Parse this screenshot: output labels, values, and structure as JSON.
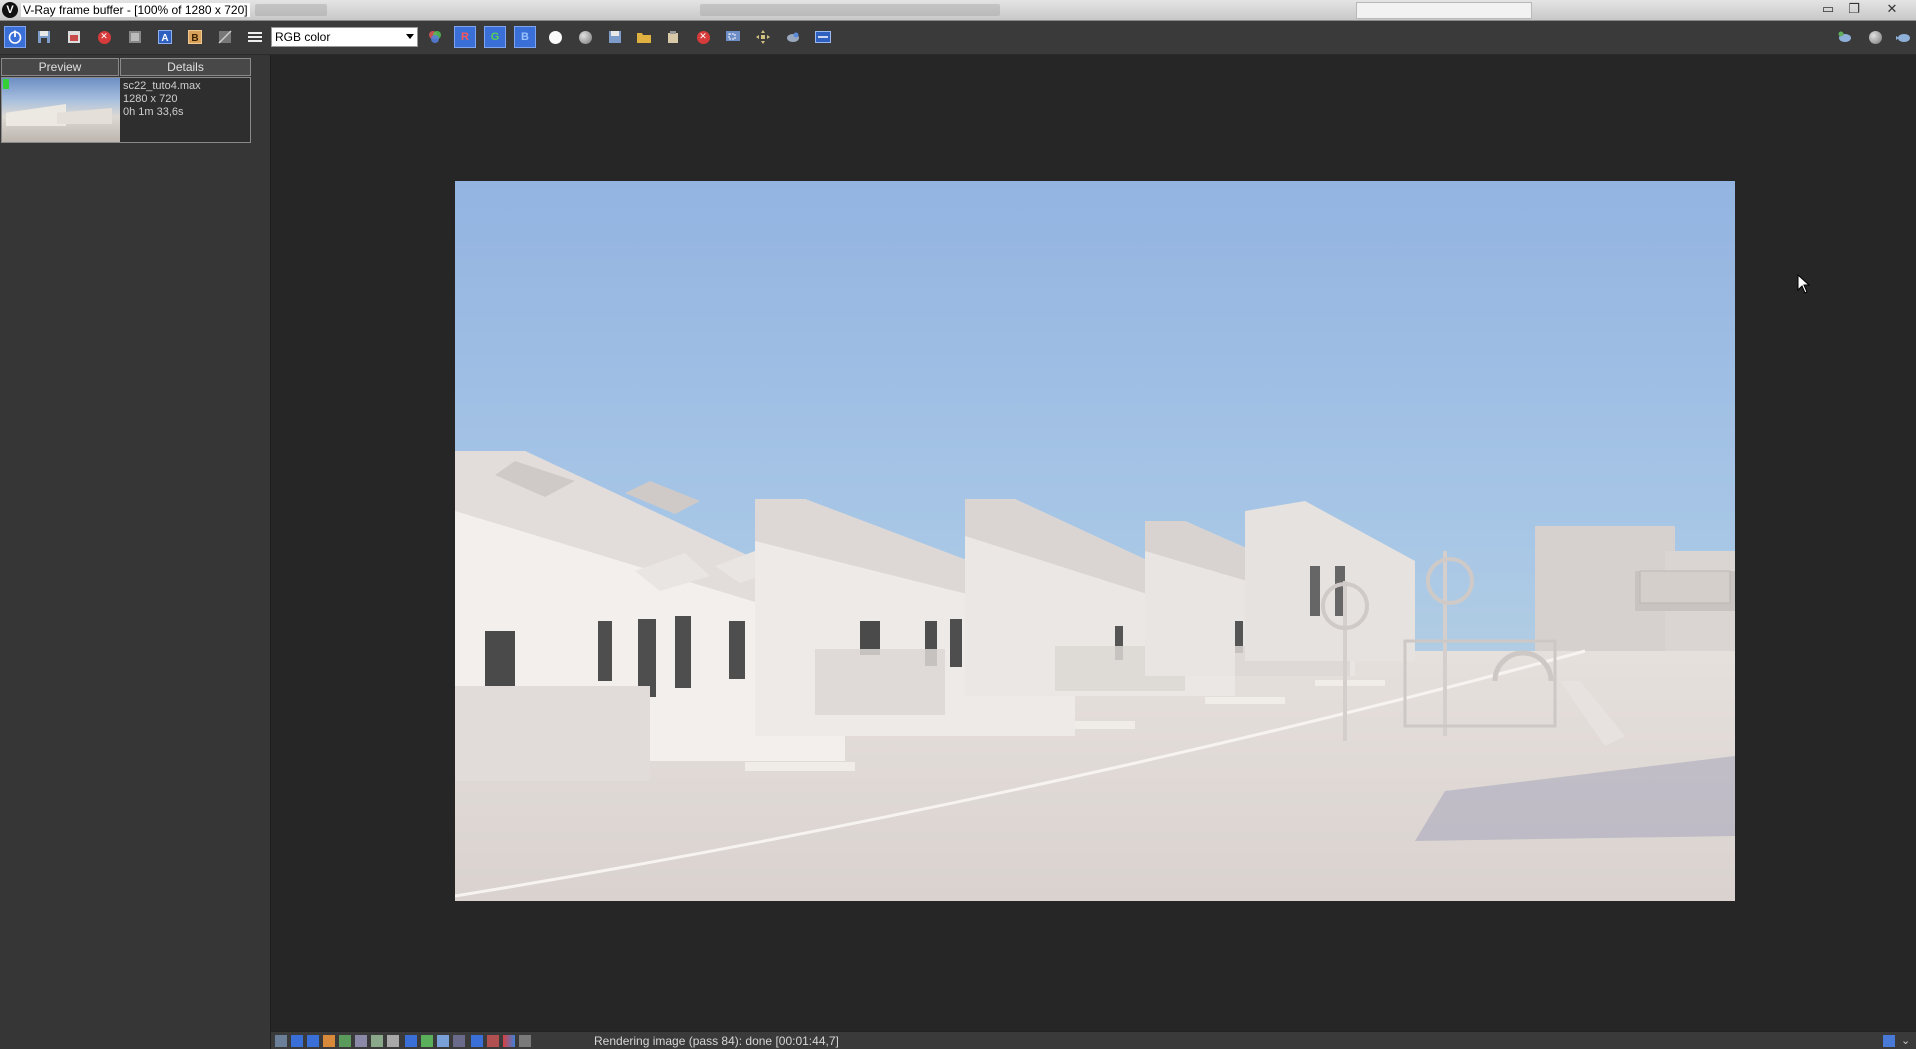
{
  "window": {
    "title": "V-Ray frame buffer - [100% of 1280 x 720]",
    "minimize": "▭",
    "restore": "❐",
    "close": "✕"
  },
  "toolbar": {
    "channel_select": "RGB color",
    "red_channel": "R",
    "green_channel": "G",
    "blue_channel": "B",
    "label_a": "A",
    "label_b": "B"
  },
  "history": {
    "tab_preview": "Preview",
    "tab_details": "Details",
    "items": [
      {
        "filename": "sc22_tuto4.max",
        "resolution": "1280 x 720",
        "render_time": "0h 1m 33,6s"
      }
    ]
  },
  "status": {
    "message": "Rendering image (pass 84): done [00:01:44,7]"
  },
  "colors": {
    "accent": "#3a6fd8",
    "background": "#262626",
    "panel": "#363636",
    "toolbar": "#3a3a3a",
    "sky_top": "#94b4e2",
    "sky_horizon": "#a9c8e4",
    "ground": "#e6e0dc"
  },
  "icons": {
    "toolbar": [
      "vray-power-icon",
      "save-icon",
      "save-all-icon",
      "clear-icon",
      "copy-icon",
      "compare-a-icon",
      "compare-b-icon",
      "ab-split-icon",
      "menu-icon",
      "color-correction-icon",
      "red-channel-icon",
      "green-channel-icon",
      "blue-channel-icon",
      "white-color-icon",
      "mono-icon",
      "save-image-icon",
      "load-image-icon",
      "clear-image-icon",
      "stop-render-icon",
      "region-render-icon",
      "track-mouse-icon",
      "render-icon",
      "lens-effects-icon"
    ],
    "right": [
      "teapot-render-icon",
      "gray-sphere-icon",
      "teapot-icon"
    ]
  }
}
